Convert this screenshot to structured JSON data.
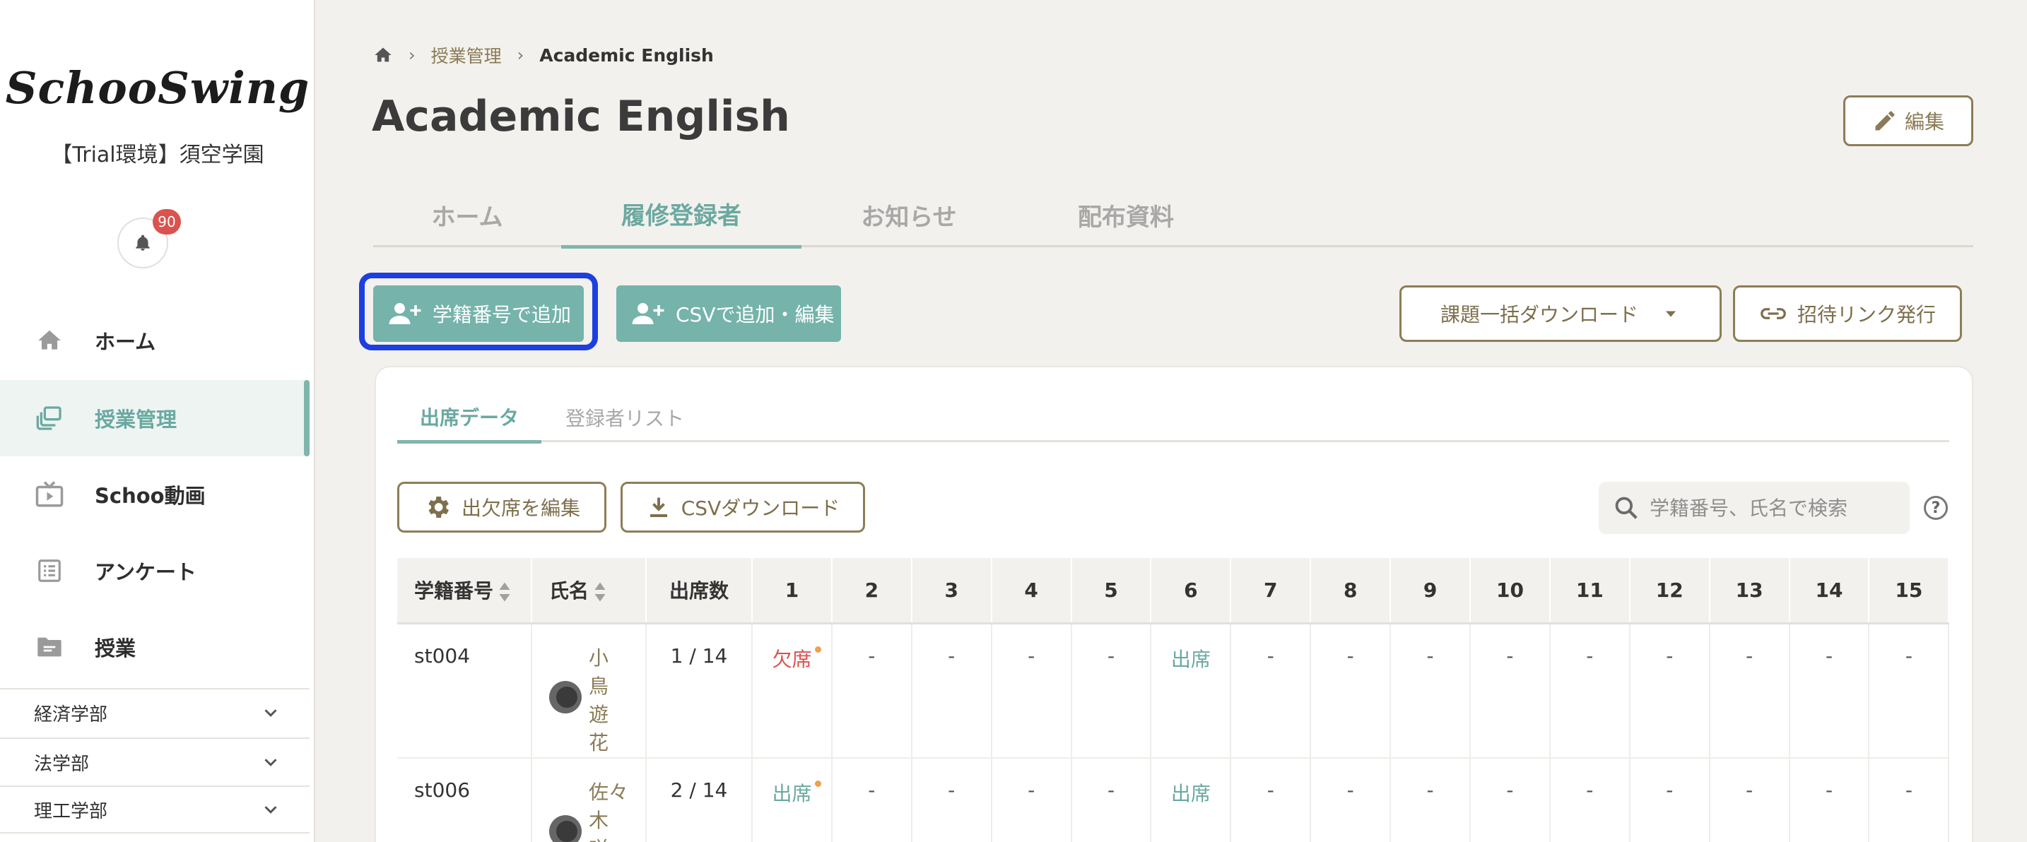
{
  "sidebar": {
    "logo": "SchooSwing",
    "org_name": "【Trial環境】須空学園",
    "notification_count": "90",
    "nav": [
      {
        "label": "ホーム",
        "icon": "home-icon"
      },
      {
        "label": "授業管理",
        "icon": "class-management-icon",
        "active": true
      },
      {
        "label": "Schoo動画",
        "icon": "tv-icon"
      },
      {
        "label": "アンケート",
        "icon": "survey-list-icon"
      },
      {
        "label": "授業",
        "icon": "folder-icon"
      }
    ],
    "faculties": [
      {
        "label": "経済学部"
      },
      {
        "label": "法学部"
      },
      {
        "label": "理工学部"
      }
    ]
  },
  "breadcrumb": {
    "parent": "授業管理",
    "current": "Academic English"
  },
  "page": {
    "title": "Academic English",
    "edit_label": "編集"
  },
  "tabs": [
    {
      "label": "ホーム"
    },
    {
      "label": "履修登録者",
      "active": true
    },
    {
      "label": "お知らせ"
    },
    {
      "label": "配布資料"
    }
  ],
  "actions": {
    "add_by_student_id": "学籍番号で追加",
    "add_by_csv": "CSVで追加・編集",
    "bulk_download": "課題一括ダウンロード",
    "invite_link": "招待リンク発行"
  },
  "subtabs": [
    {
      "label": "出席データ",
      "active": true
    },
    {
      "label": "登録者リスト"
    }
  ],
  "tools": {
    "edit_attendance": "出欠席を編集",
    "csv_download": "CSVダウンロード",
    "search_placeholder": "学籍番号、氏名で検索",
    "help": "?"
  },
  "table": {
    "headers": {
      "student_id": "学籍番号",
      "name": "氏名",
      "attendance_count": "出席数",
      "sessions": [
        "1",
        "2",
        "3",
        "4",
        "5",
        "6",
        "7",
        "8",
        "9",
        "10",
        "11",
        "12",
        "13",
        "14",
        "15"
      ]
    },
    "rows": [
      {
        "student_id": "st004",
        "name": "小鳥遊花",
        "attendance_count": "1 / 14",
        "sessions": [
          "欠席",
          "-",
          "-",
          "-",
          "-",
          "出席",
          "-",
          "-",
          "-",
          "-",
          "-",
          "-",
          "-",
          "-",
          "-"
        ]
      },
      {
        "student_id": "st006",
        "name": "佐々木咲",
        "attendance_count": "2 / 14",
        "sessions": [
          "出席",
          "-",
          "-",
          "-",
          "-",
          "出席",
          "-",
          "-",
          "-",
          "-",
          "-",
          "-",
          "-",
          "-",
          "-"
        ]
      }
    ]
  },
  "colors": {
    "accent": "#75b3ab",
    "brown": "#8d7d57",
    "absent": "#d9534f",
    "focus": "#1b3fe0"
  }
}
